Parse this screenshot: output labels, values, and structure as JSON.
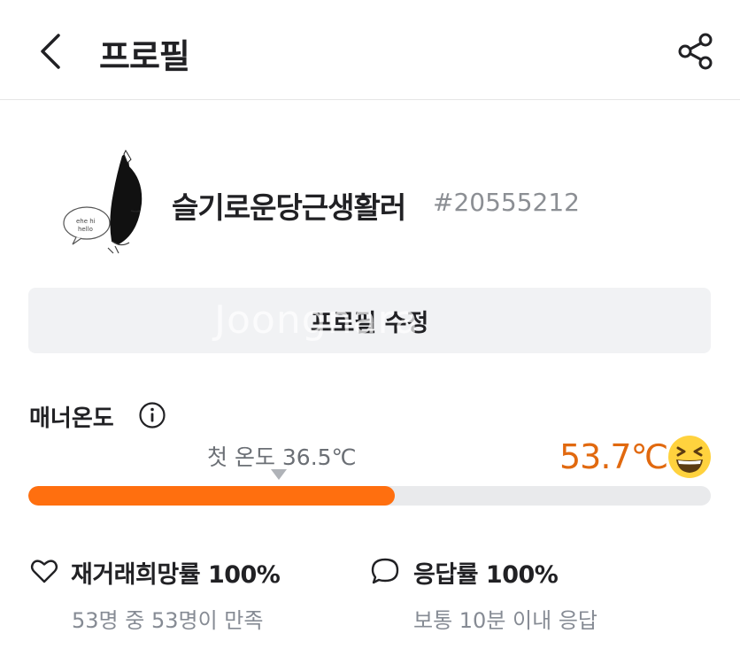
{
  "header": {
    "title": "프로필",
    "back_icon": "chevron-left-icon",
    "share_icon": "share-icon"
  },
  "profile": {
    "nickname": "슬기로운당근생활러",
    "user_id": "#20555212",
    "avatar": "cartoon-avatar"
  },
  "edit_button": {
    "label": "프로필 수정"
  },
  "watermark": "Joongnara",
  "manner": {
    "label": "매너온도",
    "info_icon": "info-icon",
    "first_temp_label": "첫 온도 36.5℃",
    "temperature": "53.7℃",
    "fill_fraction": 0.537,
    "emoji": "grinning-squint-emoji",
    "accent_color": "#e1690f",
    "bar_color": "#ff6f0f"
  },
  "stats": {
    "retrade": {
      "icon": "heart-icon",
      "title": "재거래희망률 100%",
      "subtitle": "53명 중 53명이 만족"
    },
    "response": {
      "icon": "speech-bubble-icon",
      "title": "응답률 100%",
      "subtitle": "보통 10분 이내 응답"
    }
  }
}
